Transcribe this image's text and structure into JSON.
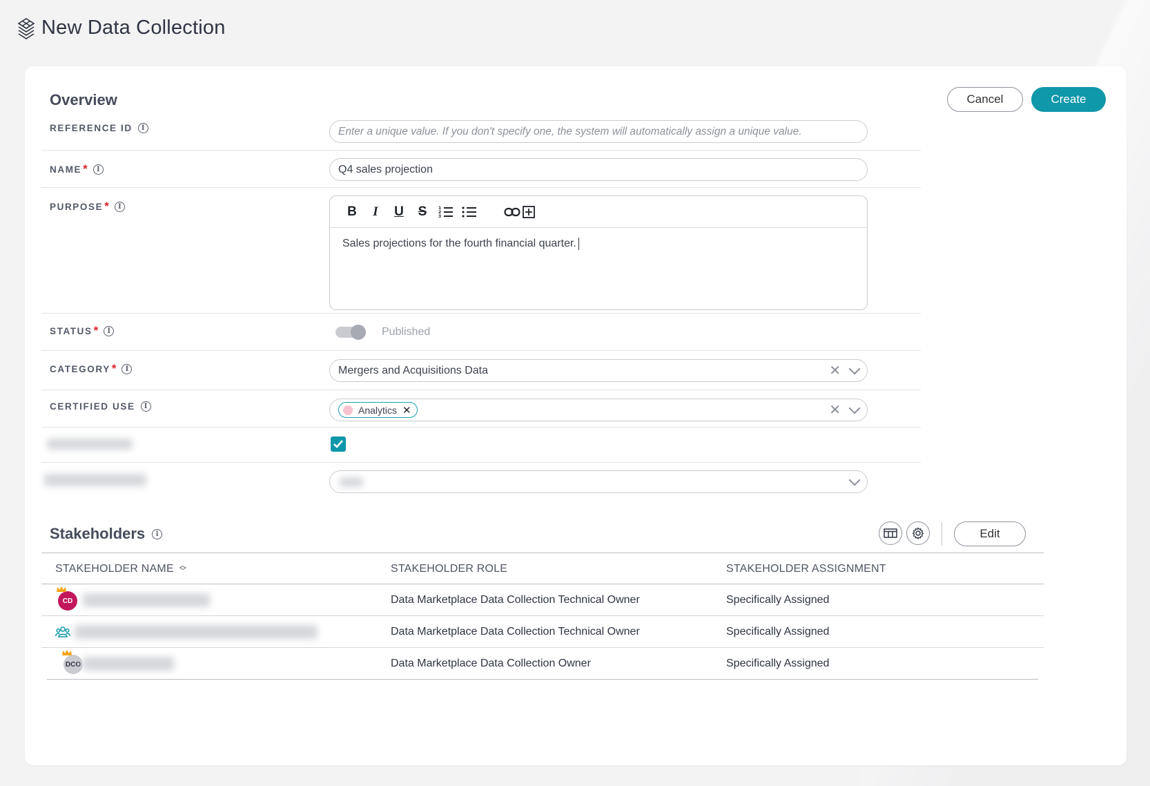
{
  "page": {
    "title": "New Data Collection"
  },
  "actions": {
    "cancel": "Cancel",
    "create": "Create"
  },
  "overview": {
    "title": "Overview",
    "reference_id": {
      "label": "REFERENCE ID",
      "placeholder": "Enter a unique value. If you don't specify one, the system will automatically assign a unique value."
    },
    "name": {
      "label": "NAME",
      "value": "Q4 sales projection"
    },
    "purpose": {
      "label": "PURPOSE",
      "value": "Sales projections for the fourth financial quarter."
    },
    "status": {
      "label": "STATUS",
      "value": "Published"
    },
    "category": {
      "label": "CATEGORY",
      "value": "Mergers and Acquisitions Data"
    },
    "certified_use": {
      "label": "CERTIFIED USE",
      "chip": "Analytics"
    }
  },
  "stakeholders": {
    "title": "Stakeholders",
    "edit": "Edit",
    "columns": [
      "STAKEHOLDER NAME",
      "STAKEHOLDER ROLE",
      "STAKEHOLDER ASSIGNMENT"
    ],
    "rows": [
      {
        "avatar": "CD",
        "role": "Data Marketplace Data Collection Technical Owner",
        "assignment": "Specifically Assigned"
      },
      {
        "avatar": "",
        "role": "Data Marketplace Data Collection Technical Owner",
        "assignment": "Specifically Assigned"
      },
      {
        "avatar": "DCO",
        "role": "Data Marketplace Data Collection Owner",
        "assignment": "Specifically Assigned"
      }
    ]
  },
  "colors": {
    "accent": "#0f97aa",
    "required": "#d9232e",
    "avatar_cd": "#c2185b",
    "avatar_dco": "#c9cbd0"
  }
}
